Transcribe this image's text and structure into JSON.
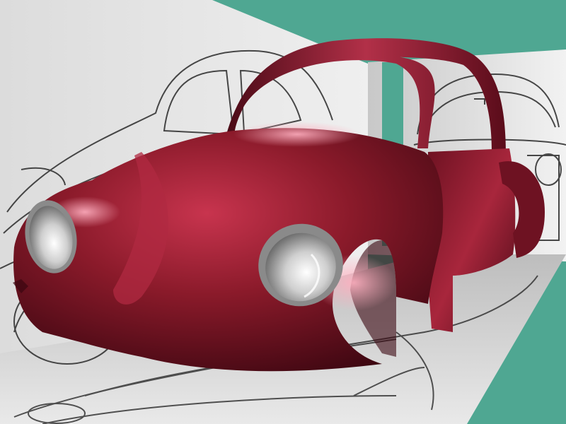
{
  "scene": {
    "subject": "car-body-3d-render",
    "colors": {
      "backdrop_teal": "#4fa792",
      "panel_light": "#e6e6e6",
      "panel_mid": "#cfcfcf",
      "panel_dark": "#a9a9a9",
      "sketch_line": "#2a2a2a",
      "paint_base": "#8a1a2a",
      "paint_highlight": "#e0607a",
      "paint_shadow": "#3a0610",
      "headlight_glass": "#d8d8d8",
      "chrome_ring": "#9a9a9a"
    }
  }
}
